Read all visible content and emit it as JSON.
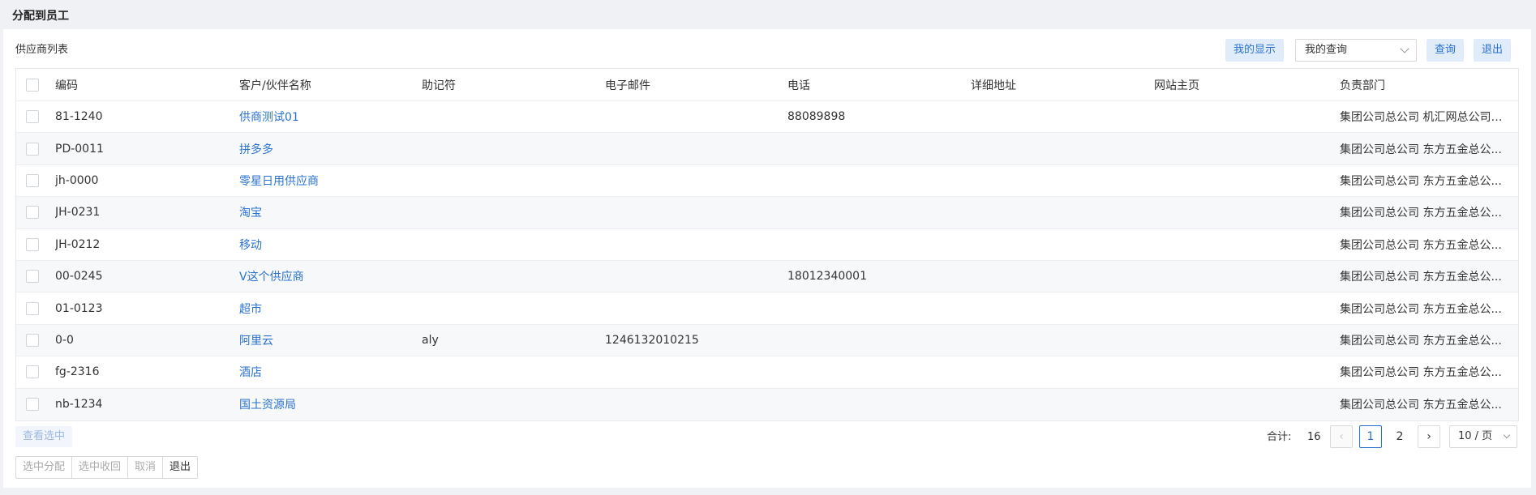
{
  "page": {
    "title": "分配到员工"
  },
  "toolbar": {
    "section_title": "供应商列表",
    "my_display": "我的显示",
    "my_query": "我的查询",
    "query": "查询",
    "exit": "退出"
  },
  "table": {
    "headers": [
      "编码",
      "客户/伙伴名称",
      "助记符",
      "电子邮件",
      "电话",
      "详细地址",
      "网站主页",
      "负责部门"
    ],
    "rows": [
      {
        "code": "81-1240",
        "name": "供商测试01",
        "mnemonic": "",
        "email": "",
        "phone": "88089898",
        "address": "",
        "website": "",
        "dept": "集团公司总公司 机汇网总公司 ..."
      },
      {
        "code": "PD-0011",
        "name": "拼多多",
        "mnemonic": "",
        "email": "",
        "phone": "",
        "address": "",
        "website": "",
        "dept": "集团公司总公司 东方五金总公..."
      },
      {
        "code": "jh-0000",
        "name": "零星日用供应商",
        "mnemonic": "",
        "email": "",
        "phone": "",
        "address": "",
        "website": "",
        "dept": "集团公司总公司 东方五金总公..."
      },
      {
        "code": "JH-0231",
        "name": "淘宝",
        "mnemonic": "",
        "email": "",
        "phone": "",
        "address": "",
        "website": "",
        "dept": "集团公司总公司 东方五金总公..."
      },
      {
        "code": "JH-0212",
        "name": "移动",
        "mnemonic": "",
        "email": "",
        "phone": "",
        "address": "",
        "website": "",
        "dept": "集团公司总公司 东方五金总公..."
      },
      {
        "code": "00-0245",
        "name": "V这个供应商",
        "mnemonic": "",
        "email": "",
        "phone": "18012340001",
        "address": "",
        "website": "",
        "dept": "集团公司总公司 东方五金总公..."
      },
      {
        "code": "01-0123",
        "name": "超市",
        "mnemonic": "",
        "email": "",
        "phone": "",
        "address": "",
        "website": "",
        "dept": "集团公司总公司 东方五金总公..."
      },
      {
        "code": "0-0",
        "name": "阿里云",
        "mnemonic": "aly",
        "email": "1246132010215",
        "phone": "",
        "address": "",
        "website": "",
        "dept": "集团公司总公司 东方五金总公..."
      },
      {
        "code": "fg-2316",
        "name": "酒店",
        "mnemonic": "",
        "email": "",
        "phone": "",
        "address": "",
        "website": "",
        "dept": "集团公司总公司 东方五金总公..."
      },
      {
        "code": "nb-1234",
        "name": "国土资源局",
        "mnemonic": "",
        "email": "",
        "phone": "",
        "address": "",
        "website": "",
        "dept": "集团公司总公司 东方五金总公..."
      }
    ]
  },
  "footer": {
    "view_selected": "查看选中",
    "assign_selected": "选中分配",
    "recall_selected": "选中收回",
    "cancel": "取消",
    "exit": "退出"
  },
  "pagination": {
    "total_label": "合计:",
    "total": "16",
    "prev_icon": "‹",
    "next_icon": "›",
    "pages": [
      "1",
      "2"
    ],
    "current_page": "1",
    "page_size": "10 / 页"
  }
}
